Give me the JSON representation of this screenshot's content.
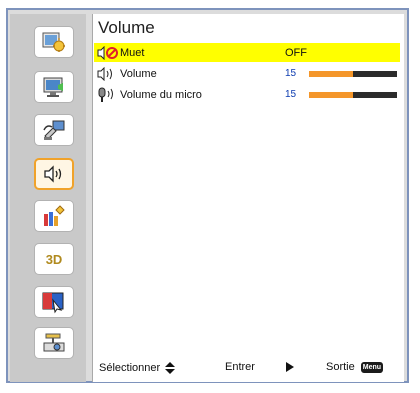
{
  "page": {
    "title": "Volume"
  },
  "sidebar": {
    "items": [
      {
        "name": "image-settings",
        "icon": "image-settings-icon",
        "selected": false
      },
      {
        "name": "display-settings",
        "icon": "display-settings-icon",
        "selected": false
      },
      {
        "name": "setup",
        "icon": "setup-icon",
        "selected": false
      },
      {
        "name": "volume",
        "icon": "speaker-icon",
        "selected": true
      },
      {
        "name": "options",
        "icon": "options-icon",
        "selected": false
      },
      {
        "name": "3d",
        "icon": "3d-icon",
        "label": "3D",
        "selected": false
      },
      {
        "name": "interactive",
        "icon": "interactive-icon",
        "selected": false
      },
      {
        "name": "lan",
        "icon": "lan-icon",
        "selected": false
      }
    ]
  },
  "menu": {
    "rows": [
      {
        "label": "Muet",
        "value": "OFF",
        "icon": "mute-icon",
        "selected": true
      },
      {
        "label": "Volume",
        "value": "15",
        "icon": "speaker-icon",
        "level": 0.5,
        "selected": false
      },
      {
        "label": "Volume du micro",
        "value": "15",
        "icon": "microphone-icon",
        "level": 0.5,
        "selected": false
      }
    ]
  },
  "footer": {
    "select_label": "Sélectionner",
    "enter_label": "Entrer",
    "exit_label": "Sortie",
    "menu_key": "Menu"
  },
  "colors": {
    "selected_row": "#ffff00",
    "value_text": "#0c3bb0",
    "bar_fill": "#f4962a",
    "bar_bg": "#2b2b2b",
    "active_tab_border": "#f0a22a",
    "frame_border": "#7e93bc"
  }
}
